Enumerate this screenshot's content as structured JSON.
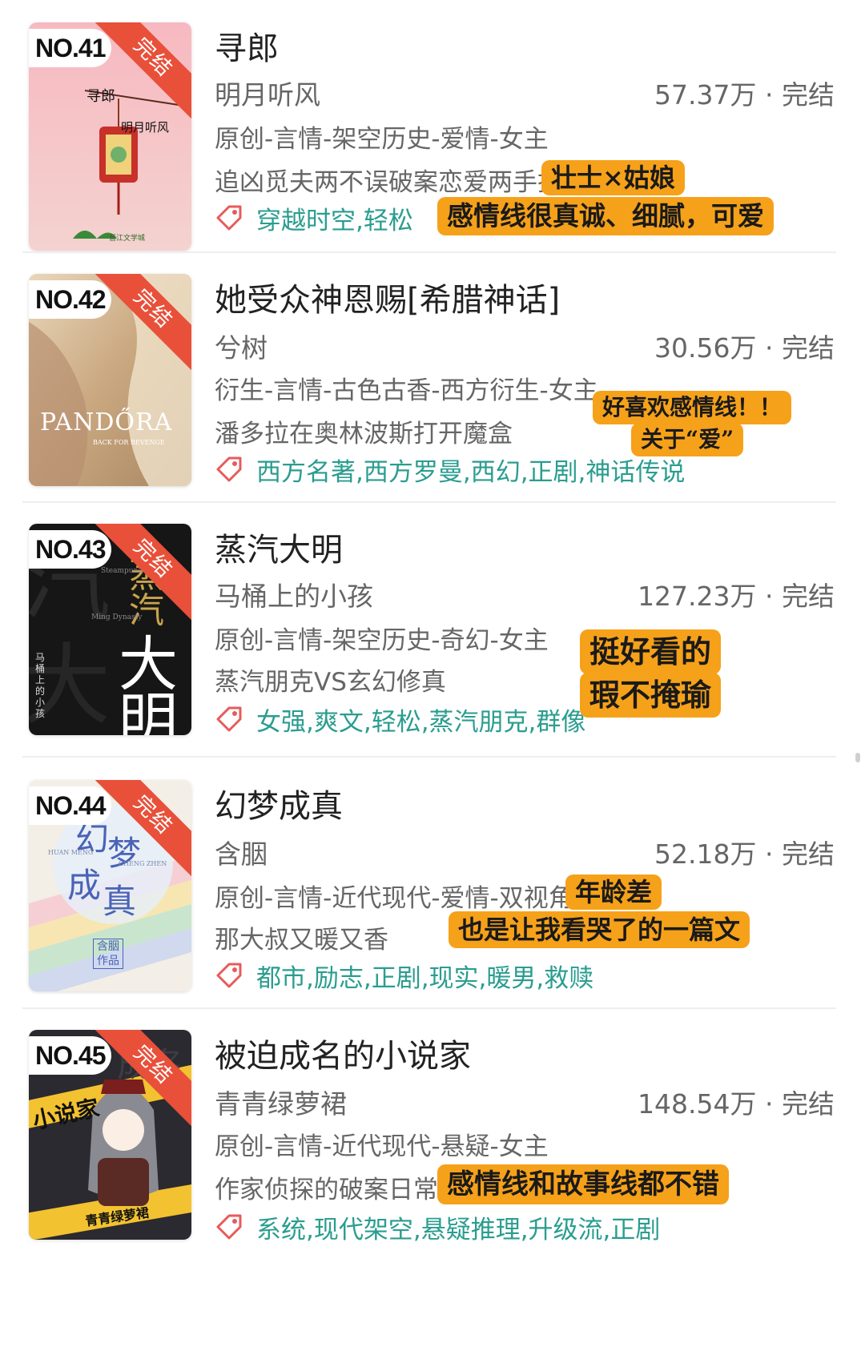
{
  "status_label": "完结",
  "books": [
    {
      "rank": "NO.41",
      "title": "寻郎",
      "author": "明月听风",
      "count": "57.37万 · 完结",
      "genre": "原创-言情-架空历史-爱情-女主",
      "desc": "追凶觅夫两不误破案恋爱两手抓",
      "tags": "穿越时空,轻松",
      "notes": [
        "壮士×姑娘",
        "感情线很真诚、细腻，可爱"
      ],
      "cover": {
        "title": "寻郎",
        "author": "明月听风",
        "mark": "晋江文学城"
      }
    },
    {
      "rank": "NO.42",
      "title": "她受众神恩赐[希腊神话]",
      "author": "兮树",
      "count": "30.56万 · 完结",
      "genre": "衍生-言情-古色古香-西方衍生-女主",
      "desc": "潘多拉在奥林波斯打开魔盒",
      "tags": "西方名著,西方罗曼,西幻,正剧,神话传说",
      "notes": [
        "好喜欢感情线！！",
        "关于“爱”"
      ],
      "cover": {
        "title": "PANDŐRA",
        "subtitle": "BACK FOR REVENGE"
      }
    },
    {
      "rank": "NO.43",
      "title": "蒸汽大明",
      "author": "马桶上的小孩",
      "count": "127.23万 · 完结",
      "genre": "原创-言情-架空历史-奇幻-女主",
      "desc": "蒸汽朋克VS玄幻修真",
      "tags": "女强,爽文,轻松,蒸汽朋克,群像",
      "notes": [
        "挺好看的",
        "瑕不掩瑜"
      ],
      "cover": {
        "title_top": "蒸",
        "title_mid": "汽",
        "title_big1": "大",
        "title_big2": "明",
        "en1": "Steampunk",
        "en2": "Ming Dynasty",
        "author": "马桶上的小孩"
      }
    },
    {
      "rank": "NO.44",
      "title": "幻梦成真",
      "author": "含胭",
      "count": "52.18万 · 完结",
      "genre": "原创-言情-近代现代-爱情-双视角",
      "desc": "那大叔又暖又香",
      "tags": "都市,励志,正剧,现实,暖男,救赎",
      "notes": [
        "年龄差",
        "也是让我看哭了的一篇文"
      ],
      "cover": {
        "t1": "幻",
        "t2": "梦",
        "t3": "成",
        "t4": "真",
        "en1": "HUAN MENG",
        "en2": "CHENG ZHEN",
        "seal": "含胭作品"
      }
    },
    {
      "rank": "NO.45",
      "title": "被迫成名的小说家",
      "author": "青青绿萝裙",
      "count": "148.54万 · 完结",
      "genre": "原创-言情-近代现代-悬疑-女主",
      "desc": "作家侦探的破案日常",
      "tags": "系统,现代架空,悬疑推理,升级流,正剧",
      "notes": [
        "感情线和故事线都不错"
      ],
      "cover": {
        "banner": "小说家",
        "bg": "成名",
        "author": "青青绿萝裙"
      }
    }
  ],
  "colors": {
    "tag": "#2a9d8f",
    "ribbon": "#e8503a",
    "note": "#f6a11a"
  }
}
